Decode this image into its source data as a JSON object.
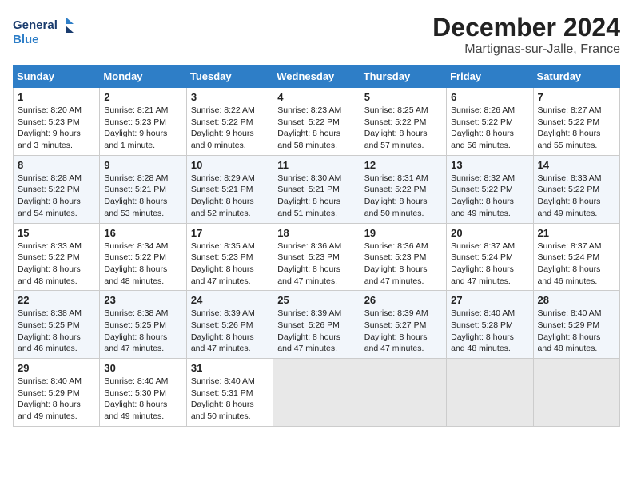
{
  "header": {
    "logo_general": "General",
    "logo_blue": "Blue",
    "title": "December 2024",
    "subtitle": "Martignas-sur-Jalle, France"
  },
  "calendar": {
    "weekdays": [
      "Sunday",
      "Monday",
      "Tuesday",
      "Wednesday",
      "Thursday",
      "Friday",
      "Saturday"
    ],
    "weeks": [
      [
        {
          "day": "1",
          "lines": [
            "Sunrise: 8:20 AM",
            "Sunset: 5:23 PM",
            "Daylight: 9 hours",
            "and 3 minutes."
          ]
        },
        {
          "day": "2",
          "lines": [
            "Sunrise: 8:21 AM",
            "Sunset: 5:23 PM",
            "Daylight: 9 hours",
            "and 1 minute."
          ]
        },
        {
          "day": "3",
          "lines": [
            "Sunrise: 8:22 AM",
            "Sunset: 5:22 PM",
            "Daylight: 9 hours",
            "and 0 minutes."
          ]
        },
        {
          "day": "4",
          "lines": [
            "Sunrise: 8:23 AM",
            "Sunset: 5:22 PM",
            "Daylight: 8 hours",
            "and 58 minutes."
          ]
        },
        {
          "day": "5",
          "lines": [
            "Sunrise: 8:25 AM",
            "Sunset: 5:22 PM",
            "Daylight: 8 hours",
            "and 57 minutes."
          ]
        },
        {
          "day": "6",
          "lines": [
            "Sunrise: 8:26 AM",
            "Sunset: 5:22 PM",
            "Daylight: 8 hours",
            "and 56 minutes."
          ]
        },
        {
          "day": "7",
          "lines": [
            "Sunrise: 8:27 AM",
            "Sunset: 5:22 PM",
            "Daylight: 8 hours",
            "and 55 minutes."
          ]
        }
      ],
      [
        {
          "day": "8",
          "lines": [
            "Sunrise: 8:28 AM",
            "Sunset: 5:22 PM",
            "Daylight: 8 hours",
            "and 54 minutes."
          ]
        },
        {
          "day": "9",
          "lines": [
            "Sunrise: 8:28 AM",
            "Sunset: 5:21 PM",
            "Daylight: 8 hours",
            "and 53 minutes."
          ]
        },
        {
          "day": "10",
          "lines": [
            "Sunrise: 8:29 AM",
            "Sunset: 5:21 PM",
            "Daylight: 8 hours",
            "and 52 minutes."
          ]
        },
        {
          "day": "11",
          "lines": [
            "Sunrise: 8:30 AM",
            "Sunset: 5:21 PM",
            "Daylight: 8 hours",
            "and 51 minutes."
          ]
        },
        {
          "day": "12",
          "lines": [
            "Sunrise: 8:31 AM",
            "Sunset: 5:22 PM",
            "Daylight: 8 hours",
            "and 50 minutes."
          ]
        },
        {
          "day": "13",
          "lines": [
            "Sunrise: 8:32 AM",
            "Sunset: 5:22 PM",
            "Daylight: 8 hours",
            "and 49 minutes."
          ]
        },
        {
          "day": "14",
          "lines": [
            "Sunrise: 8:33 AM",
            "Sunset: 5:22 PM",
            "Daylight: 8 hours",
            "and 49 minutes."
          ]
        }
      ],
      [
        {
          "day": "15",
          "lines": [
            "Sunrise: 8:33 AM",
            "Sunset: 5:22 PM",
            "Daylight: 8 hours",
            "and 48 minutes."
          ]
        },
        {
          "day": "16",
          "lines": [
            "Sunrise: 8:34 AM",
            "Sunset: 5:22 PM",
            "Daylight: 8 hours",
            "and 48 minutes."
          ]
        },
        {
          "day": "17",
          "lines": [
            "Sunrise: 8:35 AM",
            "Sunset: 5:23 PM",
            "Daylight: 8 hours",
            "and 47 minutes."
          ]
        },
        {
          "day": "18",
          "lines": [
            "Sunrise: 8:36 AM",
            "Sunset: 5:23 PM",
            "Daylight: 8 hours",
            "and 47 minutes."
          ]
        },
        {
          "day": "19",
          "lines": [
            "Sunrise: 8:36 AM",
            "Sunset: 5:23 PM",
            "Daylight: 8 hours",
            "and 47 minutes."
          ]
        },
        {
          "day": "20",
          "lines": [
            "Sunrise: 8:37 AM",
            "Sunset: 5:24 PM",
            "Daylight: 8 hours",
            "and 47 minutes."
          ]
        },
        {
          "day": "21",
          "lines": [
            "Sunrise: 8:37 AM",
            "Sunset: 5:24 PM",
            "Daylight: 8 hours",
            "and 46 minutes."
          ]
        }
      ],
      [
        {
          "day": "22",
          "lines": [
            "Sunrise: 8:38 AM",
            "Sunset: 5:25 PM",
            "Daylight: 8 hours",
            "and 46 minutes."
          ]
        },
        {
          "day": "23",
          "lines": [
            "Sunrise: 8:38 AM",
            "Sunset: 5:25 PM",
            "Daylight: 8 hours",
            "and 47 minutes."
          ]
        },
        {
          "day": "24",
          "lines": [
            "Sunrise: 8:39 AM",
            "Sunset: 5:26 PM",
            "Daylight: 8 hours",
            "and 47 minutes."
          ]
        },
        {
          "day": "25",
          "lines": [
            "Sunrise: 8:39 AM",
            "Sunset: 5:26 PM",
            "Daylight: 8 hours",
            "and 47 minutes."
          ]
        },
        {
          "day": "26",
          "lines": [
            "Sunrise: 8:39 AM",
            "Sunset: 5:27 PM",
            "Daylight: 8 hours",
            "and 47 minutes."
          ]
        },
        {
          "day": "27",
          "lines": [
            "Sunrise: 8:40 AM",
            "Sunset: 5:28 PM",
            "Daylight: 8 hours",
            "and 48 minutes."
          ]
        },
        {
          "day": "28",
          "lines": [
            "Sunrise: 8:40 AM",
            "Sunset: 5:29 PM",
            "Daylight: 8 hours",
            "and 48 minutes."
          ]
        }
      ],
      [
        {
          "day": "29",
          "lines": [
            "Sunrise: 8:40 AM",
            "Sunset: 5:29 PM",
            "Daylight: 8 hours",
            "and 49 minutes."
          ]
        },
        {
          "day": "30",
          "lines": [
            "Sunrise: 8:40 AM",
            "Sunset: 5:30 PM",
            "Daylight: 8 hours",
            "and 49 minutes."
          ]
        },
        {
          "day": "31",
          "lines": [
            "Sunrise: 8:40 AM",
            "Sunset: 5:31 PM",
            "Daylight: 8 hours",
            "and 50 minutes."
          ]
        },
        {
          "day": "",
          "lines": []
        },
        {
          "day": "",
          "lines": []
        },
        {
          "day": "",
          "lines": []
        },
        {
          "day": "",
          "lines": []
        }
      ]
    ]
  }
}
